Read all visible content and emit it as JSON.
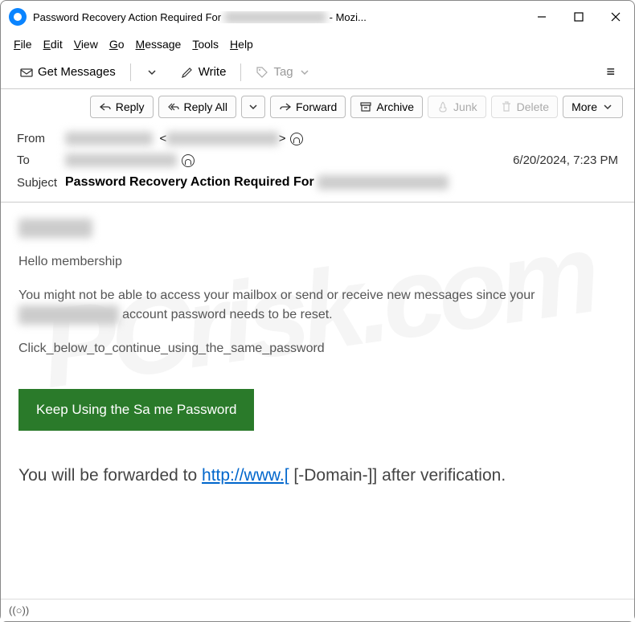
{
  "window": {
    "title_prefix": "Password Recovery Action Required For ",
    "title_suffix": " - Mozi..."
  },
  "menubar": [
    "File",
    "Edit",
    "View",
    "Go",
    "Message",
    "Tools",
    "Help"
  ],
  "toolbar": {
    "get_messages": "Get Messages",
    "write": "Write",
    "tag": "Tag"
  },
  "actions": {
    "reply": "Reply",
    "reply_all": "Reply All",
    "forward": "Forward",
    "archive": "Archive",
    "junk": "Junk",
    "delete": "Delete",
    "more": "More"
  },
  "headers": {
    "from_label": "From",
    "to_label": "To",
    "subject_label": "Subject",
    "subject_value": "Password Recovery Action Required For ",
    "date": "6/20/2024, 7:23 PM"
  },
  "body": {
    "greeting": "Hello membership",
    "line1a": "You might not be able to access your mailbox or send or receive new messages since your ",
    "line1b": " account password needs to be reset.",
    "line2": "Click_below_to_continue_using_the_same_password",
    "button": "Keep Using the Sa me Password",
    "forward_prefix": "You will be forwarded to   ",
    "forward_link": "http://www.[",
    "forward_suffix": "   [-Domain-]] after verification."
  },
  "watermark": "PCrisk.com"
}
